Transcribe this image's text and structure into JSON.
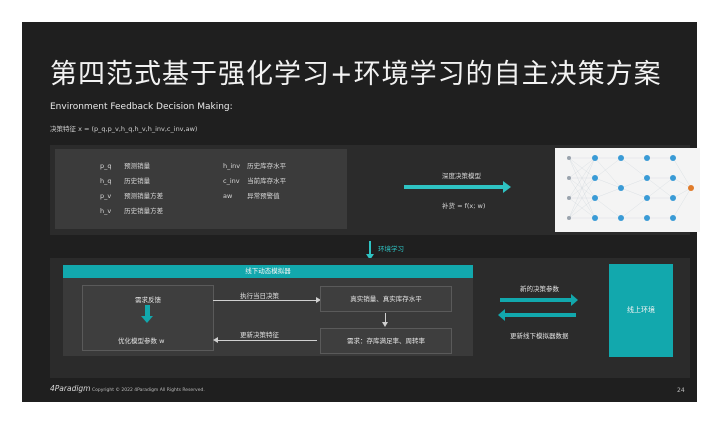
{
  "slide": {
    "title": "第四范式基于强化学习+环境学习的自主决策方案",
    "subtitle": "Environment Feedback Decision Making:",
    "formula": "决策特征 x = (p_q,p_v,h_q,h_v,h_inv,c_inv,aw)",
    "variables": [
      {
        "key": "p_q",
        "desc": "预测销量"
      },
      {
        "key": "h_q",
        "desc": "历史销量"
      },
      {
        "key": "p_v",
        "desc": "预测销量方差"
      },
      {
        "key": "h_v",
        "desc": "历史销量方差"
      },
      {
        "key": "h_inv",
        "desc": "历史库存水平"
      },
      {
        "key": "c_inv",
        "desc": "当前库存水平"
      },
      {
        "key": "aw",
        "desc": "异常预警值"
      }
    ],
    "model_label": "深度决策模型",
    "score_label": "补货 = f(x; w)",
    "env_learning_label": "环境学习",
    "simulator": {
      "title": "线下动态模拟器",
      "demand_feedback": "需求反馈",
      "optimize_params": "优化模型参数 w",
      "execute_decision": "执行当日决策",
      "update_features": "更新决策特征",
      "real_sales_inventory": "真实销量、真实库存水平",
      "demand_rates": "需求：存库满足率、周转率"
    },
    "new_params_label": "新的决策参数",
    "update_sim_data_label": "更新线下模拟器数据",
    "online_env_label": "线上环境",
    "footer": {
      "logo": "4Paradigm",
      "copyright": "Copyright © 2022 4Paradigm All Rights Reserved.",
      "page": "24"
    },
    "colors": {
      "teal": "#12a8ad",
      "background": "#1f1f1f",
      "panel": "#2b2b2b"
    }
  }
}
